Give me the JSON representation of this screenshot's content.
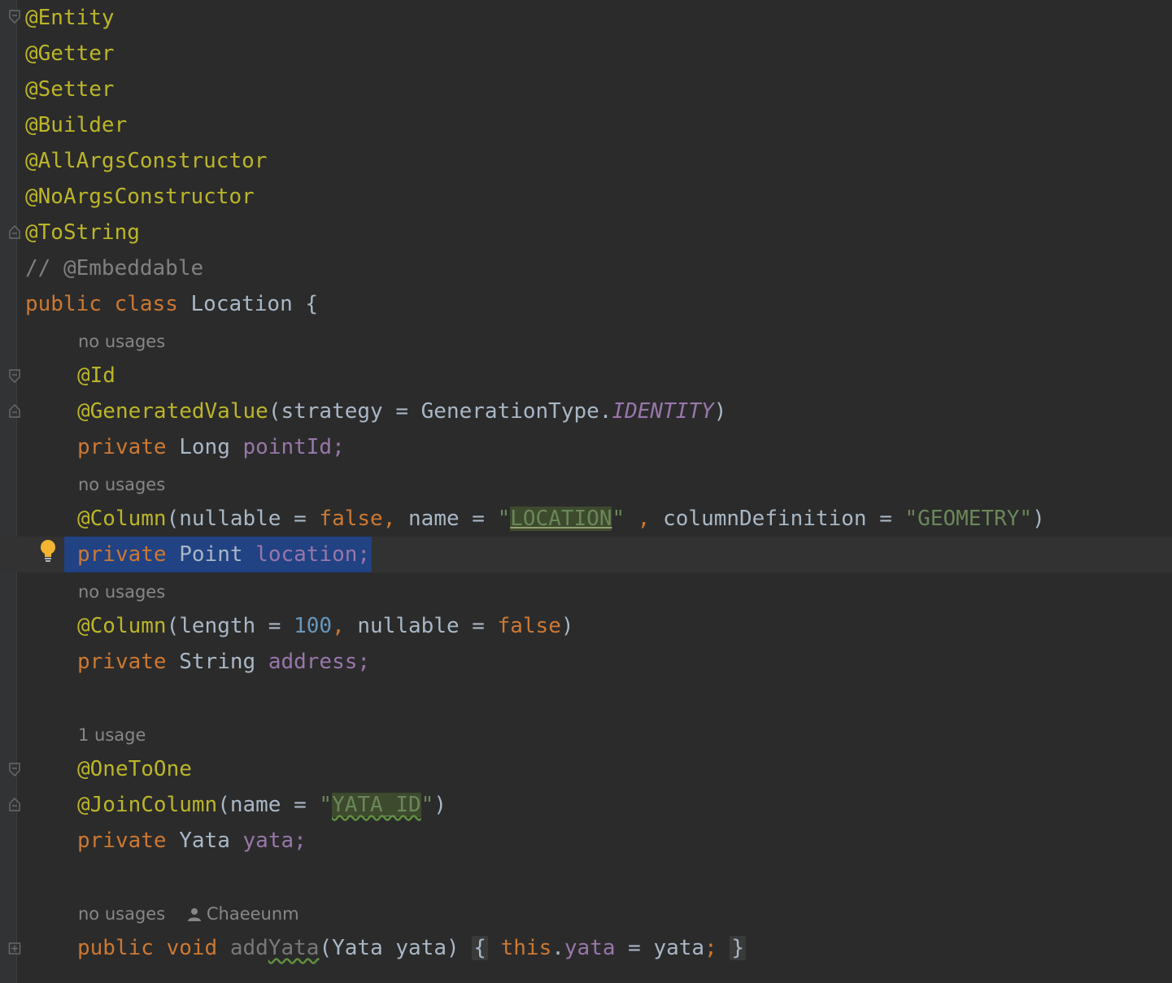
{
  "editor": {
    "annotations_top": [
      "@Entity",
      "@Getter",
      "@Setter",
      "@Builder",
      "@AllArgsConstructor",
      "@NoArgsConstructor",
      "@ToString"
    ],
    "comment": "// @Embeddable",
    "class_decl": {
      "kw_public": "public",
      "kw_class": "class",
      "name": "Location",
      "brace": "{"
    },
    "hints": {
      "h1": "no usages",
      "h2": "no usages",
      "h3": "no usages",
      "h4": "1 usage",
      "h5": "no usages",
      "h5_author": "Chaeeunm"
    },
    "field_point_id": {
      "ann_id": "@Id",
      "ann_gen": "@GeneratedValue",
      "gen_args_open": "(strategy = GenerationType.",
      "gen_enum": "IDENTITY",
      "gen_close": ")",
      "mod": "private",
      "type": "Long",
      "name": "pointId;"
    },
    "field_location": {
      "ann": "@Column",
      "args_a": "(nullable = ",
      "false": "false",
      "comma": ",",
      "args_b": " name = ",
      "q1": "\"",
      "str_val": "LOCATION",
      "q2": "\"",
      "comma2": " ,",
      "args_c": " columnDefinition = ",
      "str_geom": "\"GEOMETRY\"",
      "close": ")",
      "mod": "private",
      "type": "Point",
      "name": "location;"
    },
    "field_address": {
      "ann": "@Column",
      "args_a": "(length = ",
      "num": "100",
      "comma": ",",
      "args_b": " nullable = ",
      "false": "false",
      "close": ")",
      "mod": "private",
      "type": "String",
      "name": "address;"
    },
    "field_yata": {
      "ann_one": "@OneToOne",
      "ann_join": "@JoinColumn",
      "args_a": "(name = ",
      "q1": "\"",
      "str_val": "YATA_ID",
      "q2": "\"",
      "close": ")",
      "mod": "private",
      "type": "Yata",
      "name": "yata;"
    },
    "method_add": {
      "kw_public": "public",
      "kw_void": "void",
      "name_a": "add",
      "name_b": "Yata",
      "params": "(Yata yata)",
      "brace_open": "{",
      "kw_this": "this",
      "dot": ".",
      "field": "yata",
      "assign": " = yata",
      "semi": ";",
      "brace_close": "}"
    }
  },
  "colors": {
    "background": "#2b2b2b",
    "annotation": "#bbb529",
    "keyword": "#cc7832",
    "field": "#9876aa",
    "string": "#6a8759",
    "number": "#6897bb",
    "selection": "#214283"
  }
}
